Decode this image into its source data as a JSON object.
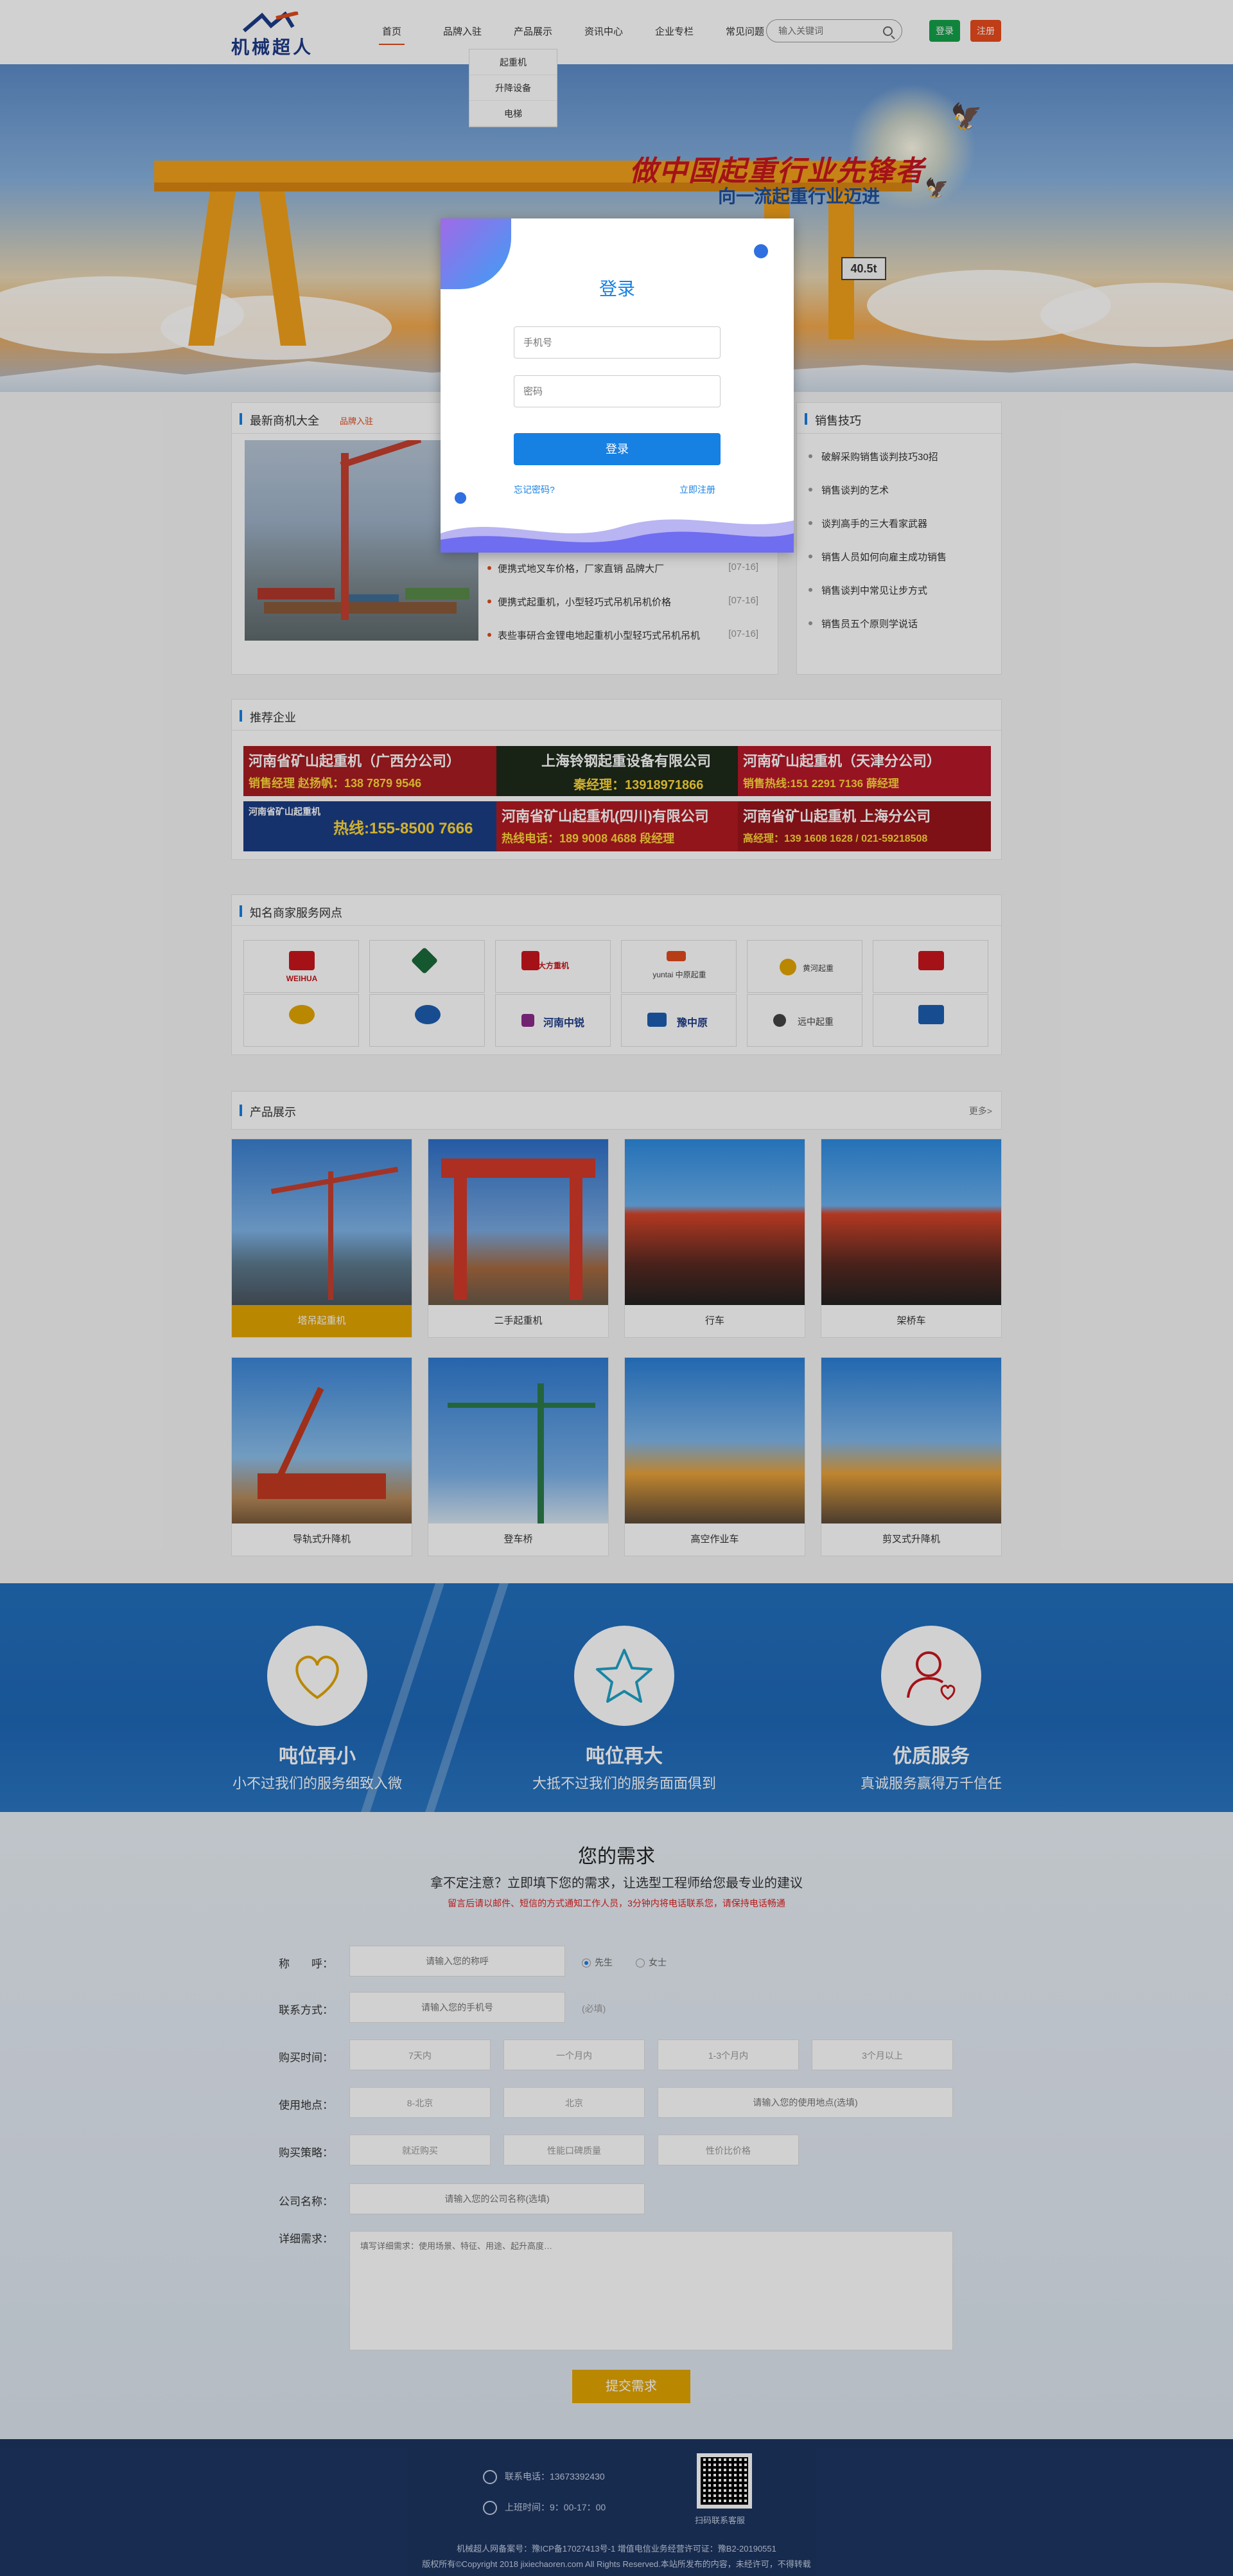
{
  "header": {
    "logo_text": "机械超人",
    "nav": [
      "首页",
      "品牌入驻",
      "产品展示",
      "资讯中心",
      "企业专栏",
      "常见问题"
    ],
    "search_placeholder": "输入关键词",
    "login_label": "登录",
    "register_label": "注册",
    "dropdown": [
      "起重机",
      "升降设备",
      "电梯"
    ]
  },
  "banner": {
    "slogan_main": "做中国起重行业先锋者",
    "slogan_sub": "向一流起重行业迈进",
    "label": "40.5t"
  },
  "login": {
    "title": "登录",
    "phone_placeholder": "手机号",
    "password_placeholder": "密码",
    "submit": "登录",
    "forgot": "忘记密码?",
    "register": "立即注册"
  },
  "news": {
    "title": "最新商机大全",
    "sub": "品牌入驻",
    "items": [
      {
        "text": "便携式地叉车价格，厂家直销 品牌大厂",
        "date": "[07-16]"
      },
      {
        "text": "便携式起重机，小型轻巧式吊机吊机价格",
        "date": "[07-16]"
      },
      {
        "text": "表些事研合金锂电地起重机小型轻巧式吊机吊机",
        "date": "[07-16]"
      }
    ]
  },
  "tips": {
    "title": "销售技巧",
    "items": [
      "破解采购销售谈判技巧30招",
      "销售谈判的艺术",
      "谈判高手的三大看家武器",
      "销售人员如何向雇主成功销售",
      "销售谈判中常见让步方式",
      "销售员五个原则学说话"
    ]
  },
  "partners": {
    "title": "推荐企业",
    "ads": [
      {
        "name": "河南省矿山起重机（广西分公司）",
        "phone": "销售经理 赵扬帆：138 7879 9546"
      },
      {
        "name": "上海铃钢起重设备有限公司",
        "phone": "秦经理：13918971866"
      },
      {
        "name": "河南矿山起重机（天津分公司）",
        "phone": "销售热线:151 2291 7136 薛经理"
      },
      {
        "name": "河南省矿山起重机",
        "phone": "热线:155-8500 7666"
      },
      {
        "name": "河南省矿山起重机(四川)有限公司",
        "phone": "热线电话：189 9008 4688 段经理"
      },
      {
        "name": "河南省矿山起重机 上海分公司",
        "phone": "高经理：139 1608 1628 / 021-59218508"
      }
    ]
  },
  "service": {
    "title": "知名商家服务网点",
    "logos": [
      "WEIHUA",
      "",
      "大方重机",
      "yuntai 中原起重",
      "黄河起重",
      "",
      "",
      "",
      "河南中锐",
      "豫中原",
      "远中起重",
      ""
    ]
  },
  "products": {
    "title": "产品展示",
    "more": "更多>",
    "items": [
      "塔吊起重机",
      "二手起重机",
      "行车",
      "架桥车",
      "导轨式升降机",
      "登车桥",
      "高空作业车",
      "剪叉式升降机"
    ]
  },
  "features": [
    {
      "title": "吨位再小",
      "sub": "小不过我们的服务细致入微"
    },
    {
      "title": "吨位再大",
      "sub": "大抵不过我们的服务面面俱到"
    },
    {
      "title": "优质服务",
      "sub": "真诚服务赢得万千信任"
    }
  ],
  "demand": {
    "title": "您的需求",
    "subtitle": "拿不定注意？立即填下您的需求，让选型工程师给您最专业的建议",
    "note": "留言后请以邮件、短信的方式通知工作人员，3分钟内将电话联系您，请保持电话畅通",
    "labels": [
      "称　　呼：",
      "联系方式：",
      "购买时间：",
      "使用地点：",
      "购买策略：",
      "公司名称：",
      "详细需求："
    ],
    "name_placeholder": "请输入您的称呼",
    "gender": [
      "先生",
      "女士"
    ],
    "phone_placeholder": "请输入您的手机号",
    "phone_hint": "(必填)",
    "times": [
      "7天内",
      "一个月内",
      "1-3个月内",
      "3个月以上"
    ],
    "place_placeholder": "请输入您的使用地点(选填)",
    "places": [
      "8-北京",
      "北京"
    ],
    "strategies": [
      "就近购买",
      "性能口碑质量",
      "性价比价格"
    ],
    "company_placeholder": "请输入您的公司名称(选填)",
    "detail_placeholder": "填写详细需求：使用场景、特征、用途、起升高度…",
    "submit": "提交需求"
  },
  "footer": {
    "phone": "联系电话：13673392430",
    "hours": "上班时间：9：00-17：00",
    "qr_label": "扫码联系客服",
    "icp": "机械超人网备案号：豫ICP备17027413号-1 增值电信业务经营许可证：豫B2-20190551",
    "copyright": "版权所有©Copyright 2018 jixiechaoren.com All Rights Reserved.本站所发布的内容，未经许可，不得转载"
  }
}
